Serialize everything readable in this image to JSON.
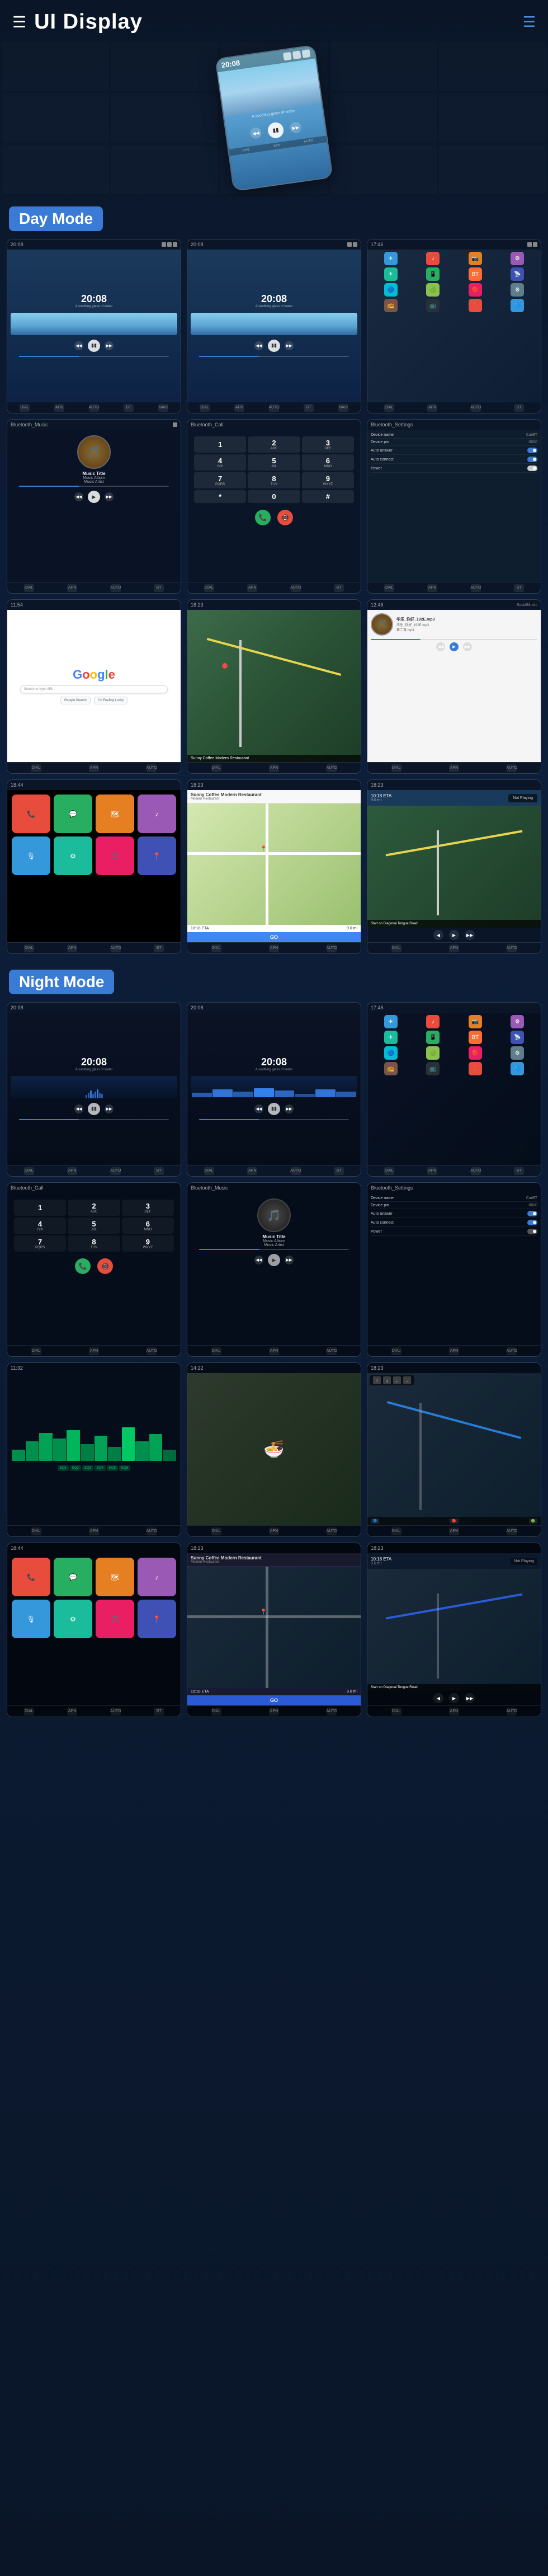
{
  "header": {
    "title": "UI Display",
    "menu_icon": "≡",
    "hamburger": "☰",
    "dots_menu": "⋮"
  },
  "hero": {
    "phone_time": "20:08",
    "phone_subtitle": "A soothing glass of water"
  },
  "day_mode": {
    "label": "Day Mode",
    "screens": [
      {
        "id": "day-music-1",
        "type": "music",
        "time": "20:08",
        "subtitle": "A soothing glass of water"
      },
      {
        "id": "day-music-2",
        "type": "music",
        "time": "20:08",
        "subtitle": "A soothing glass of water"
      },
      {
        "id": "day-apps",
        "type": "app-grid"
      },
      {
        "id": "day-bt-music",
        "type": "bluetooth-music",
        "title": "Bluetooth_Music",
        "track": "Music Title",
        "album": "Music Album",
        "artist": "Music Artist"
      },
      {
        "id": "day-bt-call",
        "type": "bluetooth-call",
        "title": "Bluetooth_Call"
      },
      {
        "id": "day-settings",
        "type": "settings",
        "title": "Bluetooth_Settings",
        "device_name": "CarBT",
        "device_pin": "0000"
      },
      {
        "id": "day-google",
        "type": "google"
      },
      {
        "id": "day-nav",
        "type": "navigation"
      },
      {
        "id": "day-social",
        "type": "social-music",
        "title": "SocialMusic"
      }
    ]
  },
  "day_mode_row2": {
    "screens": [
      {
        "id": "day-carplay",
        "type": "carplay-apps"
      },
      {
        "id": "day-restaurant",
        "type": "restaurant",
        "name": "Sunny Coffee Modern Restaurant",
        "address": "Modern Restaurant"
      },
      {
        "id": "day-nav2",
        "type": "nav-carplay",
        "distance": "10.18 ETA",
        "time": "9.0 mi"
      }
    ]
  },
  "night_mode": {
    "label": "Night Mode",
    "screens": [
      {
        "id": "night-music-1",
        "type": "music-night",
        "time": "20:08"
      },
      {
        "id": "night-music-2",
        "type": "music-night",
        "time": "20:08"
      },
      {
        "id": "night-apps",
        "type": "app-grid-night"
      },
      {
        "id": "night-bt-call",
        "type": "bluetooth-call-night",
        "title": "Bluetooth_Call"
      },
      {
        "id": "night-bt-music",
        "type": "bluetooth-music-night",
        "title": "Bluetooth_Music",
        "track": "Music Title",
        "album": "Music Album",
        "artist": "Music Artist"
      },
      {
        "id": "night-settings",
        "type": "settings-night",
        "title": "Bluetooth_Settings"
      },
      {
        "id": "night-waves",
        "type": "wave-viz"
      },
      {
        "id": "night-photo",
        "type": "photo-screen"
      },
      {
        "id": "night-nav",
        "type": "nav-night"
      }
    ]
  },
  "night_mode_row2": {
    "screens": [
      {
        "id": "night-carplay",
        "type": "carplay-night"
      },
      {
        "id": "night-restaurant",
        "type": "restaurant-night",
        "name": "Sunny Coffee Modern Restaurant"
      },
      {
        "id": "night-nav2",
        "type": "nav-carplay-night",
        "distance": "10.18 ETA",
        "time": "9.0 mi"
      }
    ]
  },
  "music_texts": {
    "title": "Music Title",
    "album": "Music Album",
    "artist": "Music Artist"
  },
  "settings_texts": {
    "device_name_label": "Device name",
    "device_name_value": "CarBT",
    "device_pin_label": "Device pin",
    "device_pin_value": "0000",
    "auto_answer_label": "Auto answer",
    "auto_connect_label": "Auto connect",
    "power_label": "Power"
  },
  "navigation_texts": {
    "restaurant_name": "Sunny Coffee Modern Restaurant",
    "restaurant_addr": "Modern Restaurant",
    "go_label": "GO",
    "eta_label": "10:18 ETA",
    "distance": "9.0 mi",
    "start_label": "Start on Diagonal Tongue Road",
    "not_playing": "Not Playing"
  },
  "bottom_nav_items": [
    "DIAL",
    "APN",
    "AUTO",
    "BT",
    "NAVI"
  ],
  "app_colors": {
    "red": "#e74c3c",
    "green": "#27ae60",
    "blue": "#3498db",
    "orange": "#e67e22",
    "purple": "#9b59b6",
    "teal": "#1abc9c",
    "pink": "#e91e63"
  }
}
